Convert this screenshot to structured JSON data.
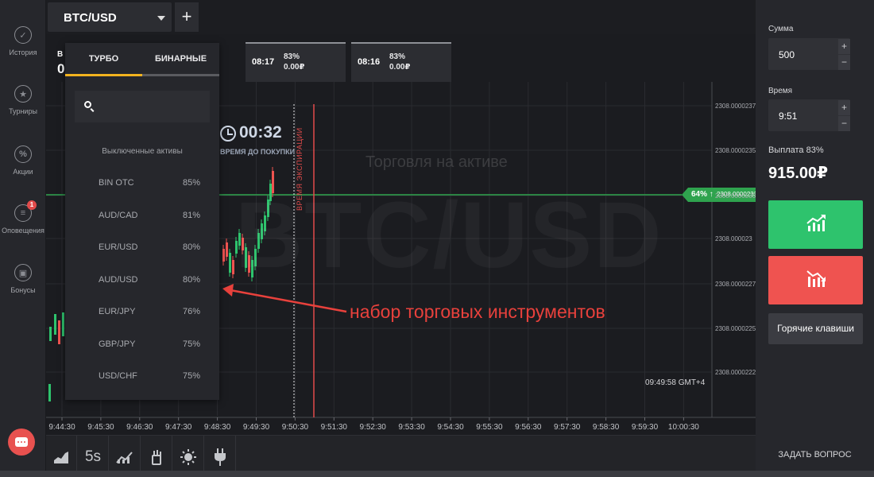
{
  "sidebar": {
    "items": [
      {
        "label": "История",
        "icon": "check-circle-icon",
        "glyph": "✓"
      },
      {
        "label": "Турниры",
        "icon": "trophy-icon",
        "glyph": "★"
      },
      {
        "label": "Акции",
        "icon": "percent-icon",
        "glyph": "%"
      },
      {
        "label": "Оповещения",
        "icon": "notifications-icon",
        "glyph": "≡",
        "badge": "1"
      },
      {
        "label": "Бонусы",
        "icon": "gift-icon",
        "glyph": "▣"
      }
    ]
  },
  "topbar": {
    "asset_tab": "BTC/USD",
    "add_tab": "+"
  },
  "chart": {
    "watermark": "BTC/USD",
    "watermark_sub": "Торговля на активе",
    "timer": {
      "value": "00:32",
      "caption": "ВРЕМЯ ДО ПОКУПКИ"
    },
    "expiry_label": "ВРЕМЯ ЭКСПИРАЦИИ",
    "annotation": "набор торговых инструментов",
    "gmt": "09:49:58 GMT+4",
    "price_tag": {
      "pct": "64% ↑",
      "value": "2308.0000233"
    },
    "hidden_label": "В",
    "hidden_value": "0",
    "y_labels": [
      "2308.0000237",
      "2308.0000235",
      "2308.0000233",
      "2308.000023",
      "2308.0000227",
      "2308.0000225",
      "2308.0000222"
    ],
    "x_labels": [
      "9:44:30",
      "9:45:30",
      "9:46:30",
      "9:47:30",
      "9:48:30",
      "9:49:30",
      "9:50:30",
      "9:51:30",
      "9:52:30",
      "9:53:30",
      "9:54:30",
      "9:55:30",
      "9:56:30",
      "9:57:30",
      "9:58:30",
      "9:59:30",
      "10:00:30"
    ],
    "deals": [
      {
        "time": "08:17",
        "pct": "83%",
        "sum": "0.00₽"
      },
      {
        "time": "08:16",
        "pct": "83%",
        "sum": "0.00₽"
      }
    ],
    "colors": {
      "up": "#2ec36d",
      "down": "#ef5350",
      "current_line": "#2fa34e",
      "expiry": "#e24b4b"
    }
  },
  "asset_panel": {
    "tabs": [
      {
        "label": "ТУРБО",
        "active": true
      },
      {
        "label": "БИНАРНЫЕ",
        "active": false
      }
    ],
    "search_placeholder": "",
    "section_title": "Выключенные активы",
    "assets": [
      {
        "name": "BIN OTC",
        "pct": "85%"
      },
      {
        "name": "AUD/CAD",
        "pct": "81%"
      },
      {
        "name": "EUR/USD",
        "pct": "80%"
      },
      {
        "name": "AUD/USD",
        "pct": "80%"
      },
      {
        "name": "EUR/JPY",
        "pct": "76%"
      },
      {
        "name": "GBP/JPY",
        "pct": "75%"
      },
      {
        "name": "USD/CHF",
        "pct": "75%"
      }
    ]
  },
  "right_panel": {
    "sum_label": "Сумма",
    "sum_value": "500",
    "time_label": "Время",
    "time_value": "9:51",
    "plus": "+",
    "minus": "−",
    "payout_label": "Выплата 83%",
    "payout_value": "915.00₽",
    "hotkeys": "Горячие клавиши",
    "ask": "ЗАДАТЬ ВОПРОС"
  },
  "bottombar": {
    "tools": [
      "area-chart-icon",
      "5s",
      "indicators-icon",
      "drawing-tools-icon",
      "theme-icon",
      "plugin-icon"
    ]
  }
}
